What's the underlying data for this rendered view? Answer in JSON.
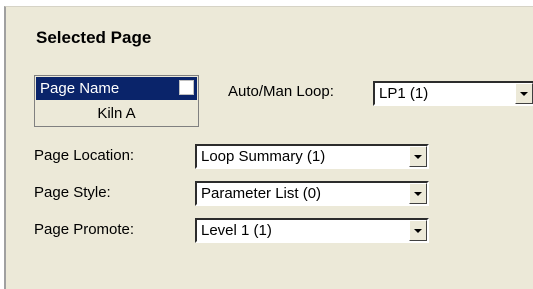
{
  "panel": {
    "title": "Selected Page"
  },
  "page_name": {
    "header": "Page Name",
    "value": "Kiln A"
  },
  "auto_man_loop": {
    "label": "Auto/Man Loop:",
    "value": "LP1 (1)"
  },
  "page_location": {
    "label": "Page Location:",
    "value": "Loop Summary (1)"
  },
  "page_style": {
    "label": "Page Style:",
    "value": "Parameter List (0)"
  },
  "page_promote": {
    "label": "Page Promote:",
    "value": "Level 1 (1)"
  },
  "icons": {
    "dropdown": "chevron-down-icon",
    "checkbox": "checkbox-icon"
  },
  "colors": {
    "panel_bg": "#ece9d8",
    "header_bg": "#0a246a",
    "header_text": "#ffffff"
  }
}
